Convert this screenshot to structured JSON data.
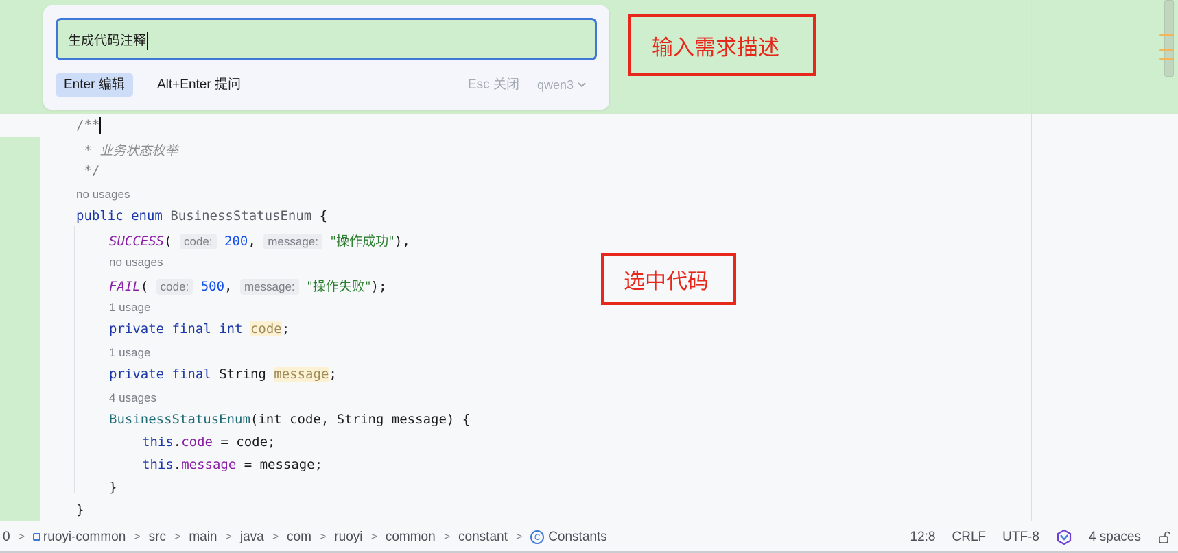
{
  "popup": {
    "prompt_value": "生成代码注释",
    "enter_label": "Enter 编辑",
    "alt_enter_label": "Alt+Enter 提问",
    "esc_label": "Esc 关闭",
    "model": "qwen3"
  },
  "annotations": {
    "input_desc": "输入需求描述",
    "selected_code": "选中代码"
  },
  "code": {
    "l1": "/**",
    "l2_star": " * ",
    "l2_text": "业务状态枚举",
    "l3": " */",
    "hint1": "no usages",
    "kw_public": "public",
    "kw_enum": "enum",
    "enum_name": "BusinessStatusEnum",
    "brace_open": " {",
    "success": "SUCCESS",
    "open_paren": "(",
    "param_code": "code:",
    "val_200": "200",
    "comma": ", ",
    "param_message": "message:",
    "str_success": "\"操作成功\"",
    "close_comma": "),",
    "hint2": "no usages",
    "fail": "FAIL",
    "val_500": "500",
    "str_fail": "\"操作失败\"",
    "close_semi": ");",
    "hint3": "1 usage",
    "kw_private": "private",
    "kw_final": "final",
    "kw_int": "int",
    "field_code": "code",
    "semi": ";",
    "hint4": "1 usage",
    "type_string": "String",
    "field_message": "message",
    "hint5": "4 usages",
    "ctor_params": "(int code, String message) {",
    "kw_this": "this",
    "assign_code": " = code;",
    "assign_message": " = message;",
    "close_inner": "}",
    "close_outer": "}"
  },
  "statusbar": {
    "crumbs": [
      "0",
      "ruoyi-common",
      "src",
      "main",
      "java",
      "com",
      "ruoyi",
      "common",
      "constant",
      "Constants"
    ],
    "position": "12:8",
    "line_ending": "CRLF",
    "encoding": "UTF-8",
    "indent": "4 spaces"
  }
}
